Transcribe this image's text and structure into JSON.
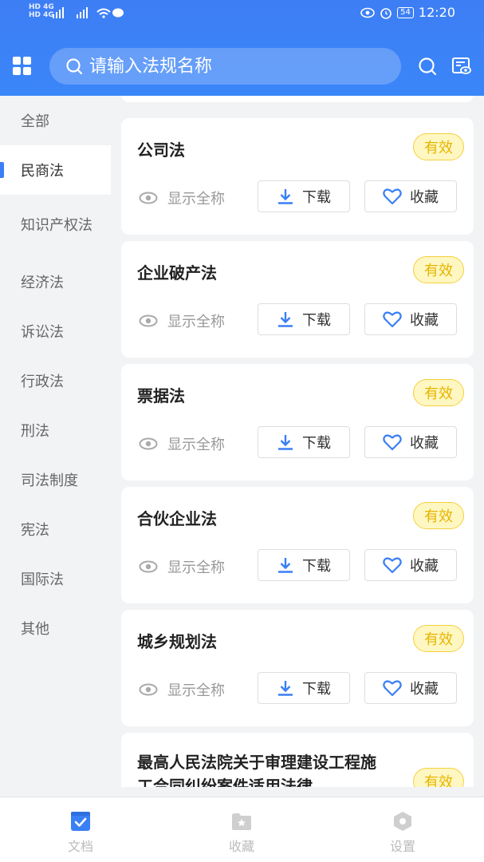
{
  "status_bar": {
    "network_left": "HD 4G",
    "network_left2": "HD 4G",
    "time": "12:20",
    "battery": "54"
  },
  "header": {
    "search_placeholder": "请输入法规名称"
  },
  "sidebar": {
    "items": [
      {
        "label": "全部"
      },
      {
        "label": "民商法"
      },
      {
        "label": "知识产权法"
      },
      {
        "label": "经济法"
      },
      {
        "label": "诉讼法"
      },
      {
        "label": "行政法"
      },
      {
        "label": "刑法"
      },
      {
        "label": "司法制度"
      },
      {
        "label": "宪法"
      },
      {
        "label": "国际法"
      },
      {
        "label": "其他"
      }
    ],
    "active_index": 1
  },
  "list": {
    "show_full_name_label": "显示全称",
    "download_label": "下载",
    "favorite_label": "收藏",
    "items": [
      {
        "title": "公司法",
        "status": "有效"
      },
      {
        "title": "企业破产法",
        "status": "有效"
      },
      {
        "title": "票据法",
        "status": "有效"
      },
      {
        "title": "合伙企业法",
        "status": "有效"
      },
      {
        "title": "城乡规划法",
        "status": "有效"
      },
      {
        "title": "最高人民法院关于审理建设工程施工合同纠纷案件适用法律",
        "status": "有效"
      }
    ]
  },
  "bottom_nav": {
    "tabs": [
      {
        "label": "文档",
        "icon": "document-check-icon"
      },
      {
        "label": "收藏",
        "icon": "folder-star-icon"
      },
      {
        "label": "设置",
        "icon": "hexagon-settings-icon"
      }
    ],
    "active_index": 0
  },
  "colors": {
    "brand": "#3a80f7",
    "badge_bg": "#fff7c2",
    "badge_text": "#e6b400"
  }
}
